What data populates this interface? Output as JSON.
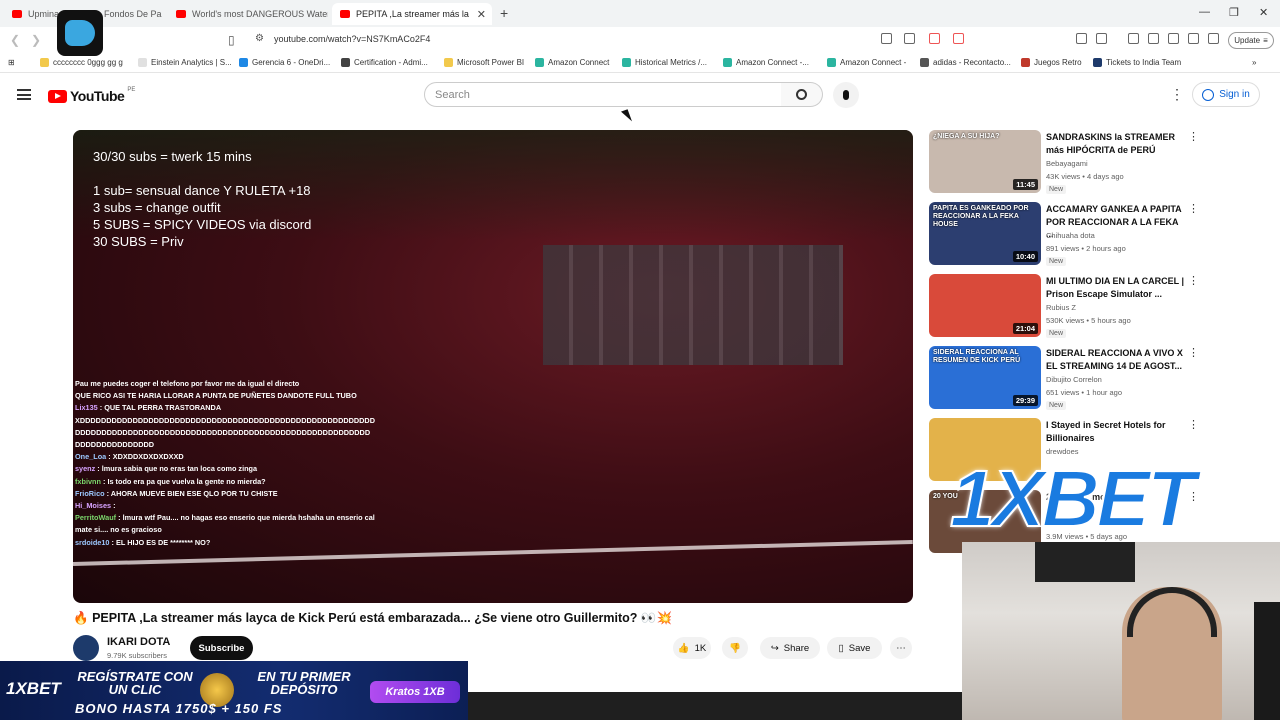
{
  "browser": {
    "tabs": [
      {
        "label": "Upmina"
      },
      {
        "label": "Fondos De Pa"
      },
      {
        "label": "World's most DANGEROUS Water Sli"
      },
      {
        "label": "PEPITA ,La streamer más la"
      }
    ],
    "url": "youtube.com/watch?v=NS7KmACo2F4",
    "update_label": "Update",
    "bookmarks": [
      {
        "label": "cccccccc 0ggg gg g",
        "color": "#f2c94c"
      },
      {
        "label": "Einstein Analytics | S...",
        "color": "#e0e0e0"
      },
      {
        "label": "Gerencia 6 - OneDri...",
        "color": "#1e88e5"
      },
      {
        "label": "Certification - Admi...",
        "color": "#424242"
      },
      {
        "label": "Microsoft Power BI",
        "color": "#f2c94c"
      },
      {
        "label": "Amazon Connect",
        "color": "#2bb5a0"
      },
      {
        "label": "Historical Metrics /...",
        "color": "#2bb5a0"
      },
      {
        "label": "Amazon Connect -...",
        "color": "#2bb5a0"
      },
      {
        "label": "Amazon Connect -",
        "color": "#2bb5a0"
      },
      {
        "label": "adidas - Recontacto...",
        "color": "#555555"
      },
      {
        "label": "Juegos Retro",
        "color": "#c0392b"
      },
      {
        "label": "Tickets to India Team",
        "color": "#1e3a6b"
      }
    ]
  },
  "youtube": {
    "logo_text": "YouTube",
    "country_code": "PE",
    "search_placeholder": "Search",
    "signin_label": "Sign in"
  },
  "video": {
    "overlay": {
      "line1": "30/30 subs = twerk 15 mins",
      "line2": "1 sub= sensual dance Y RULETA +18",
      "line3": "3 subs = change outfit",
      "line4": "5 SUBS = SPICY VIDEOS via discord",
      "line5": "30 SUBS = Priv"
    },
    "chat": [
      {
        "user": "",
        "text": "Pau me puedes coger el telefono por favor me da igual el directo"
      },
      {
        "user": "",
        "text": "QUE RICO ASI TE HARIA LLORAR A PUNTA DE PUÑETES DANDOTE FULL TUBO"
      },
      {
        "user": "Lix135",
        "text": ": QUE TAL PERRA TRASTORANDA"
      },
      {
        "user": "",
        "text": "XDDDDDDDDDDDDDDDDDDDDDDDDDDDDDDDDDDDDDDDDDDDDDDDDDDDDDDDDDDDDDDDDDDDDDDDDDDDDDDDDDDDDDDDDDDDDDDDDDDDDDDDDDDDDDDDDDDDDDDDDDDDDDDD"
      },
      {
        "user": "One_Loa",
        "text": ": XDXDDXDXDXDXXD"
      },
      {
        "user": "syenz",
        "text": ": lmura sabia que no eras tan loca como zinga"
      },
      {
        "user": "fxbivnn",
        "text": ": Is todo era pa que vuelva la gente no mierda?"
      },
      {
        "user": "FrioRico",
        "text": ": AHORA MUEVE BIEN ESE QLO POR TU CHISTE"
      },
      {
        "user": "Hi_Moises",
        "text": ":"
      },
      {
        "user": "PerritoWauf",
        "text": ": lmura wtf Pau.... no hagas eso enserio que mierda hshaha un enserio calmate si.... no es gracioso"
      },
      {
        "user": "srdoide10",
        "text": ": EL HIJO ES DE ******** NO?"
      }
    ],
    "title": "PEPITA ,La streamer más layca de Kick Perú está embarazada... ¿Se viene otro Guillermito? 👀💥",
    "title_emoji": "🔥",
    "channel_name": "IKARI DOTA",
    "subscribers": "9.79K subscribers",
    "subscribe_label": "Subscribe",
    "likes": "1K",
    "share_label": "Share",
    "save_label": "Save"
  },
  "sidebar": [
    {
      "title": "SANDRASKINS la STREAMER más HIPÓCRITA de PERÚ",
      "channel": "Bebayagami",
      "meta": "43K views • 4 days ago",
      "badge": "New",
      "duration": "11:45",
      "thumb_text": "¿NIEGA A SU HIJA?",
      "thumb_color": "#c8b9ae"
    },
    {
      "title": "ACCAMARY GANKEA A PAPITA POR REACCIONAR A LA FEKA ...",
      "channel": "Chihuaha dota",
      "meta": "891 views • 2 hours ago",
      "badge": "New",
      "duration": "10:40",
      "thumb_text": "PAPITA ES GANKEADO POR REACCIONAR A LA FEKA HOUSE",
      "thumb_color": "#2c3e70"
    },
    {
      "title": "MI ULTIMO DIA EN LA CARCEL | Prison Escape Simulator ...",
      "channel": "Rubius Z",
      "meta": "530K views • 5 hours ago",
      "badge": "New",
      "duration": "21:04",
      "thumb_text": "",
      "thumb_color": "#d94a3a"
    },
    {
      "title": "SIDERAL REACCIONA A VIVO X EL STREAMING 14 DE AGOST...",
      "channel": "Dibujito Correlon",
      "meta": "651 views • 1 hour ago",
      "badge": "New",
      "duration": "29:39",
      "thumb_text": "SIDERAL REACCIONA AL RESUMEN DE KICK PERÚ",
      "thumb_color": "#2a6fd6"
    },
    {
      "title": "I Stayed in Secret Hotels for Billionaires",
      "channel": "drewdoes",
      "meta": "",
      "badge": "",
      "duration": "",
      "thumb_text": "",
      "thumb_color": "#e3b24a"
    },
    {
      "title": "20 You... ...mony...ty",
      "channel": "",
      "meta": "3.9M views • 5 days ago",
      "badge": "",
      "duration": "",
      "thumb_text": "20 YOU",
      "thumb_color": "#6b4a3a"
    }
  ],
  "ads": {
    "bet_overlay": "1XBET",
    "banner_logo": "1XBET",
    "banner_line1": "REGÍSTRATE CON UN CLIC",
    "banner_line2": "EN TU PRIMER DEPÓSITO",
    "banner_bonus": "BONO HASTA 1750$ + 150 FS",
    "banner_partner": "Kratos 1XB"
  }
}
